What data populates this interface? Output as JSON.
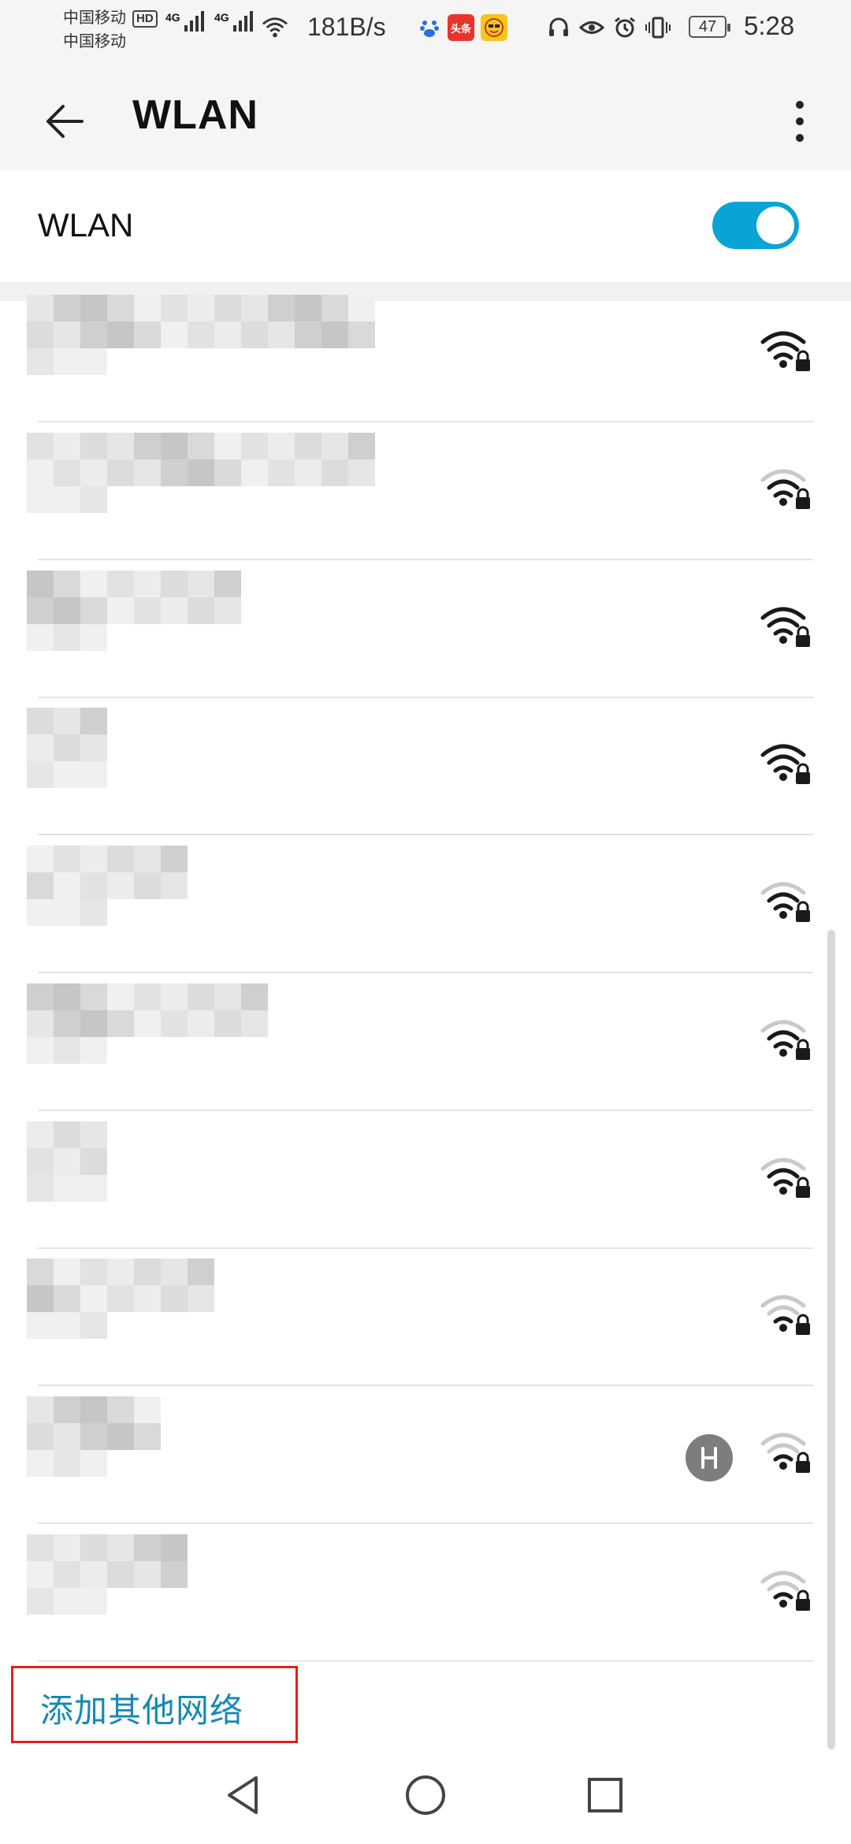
{
  "status_bar": {
    "carrier_1": "中国移动",
    "carrier_2": "中国移动",
    "hd_label": "HD",
    "signal_1_label": "4G",
    "signal_2_label": "4G",
    "net_speed": "181B/s",
    "app_icons": [
      "baidu-icon",
      "toutiao-icon",
      "emoji-app-icon"
    ],
    "toutiao_label": "头条",
    "system_icons": [
      "headphones-icon",
      "eye-icon",
      "alarm-icon",
      "vibrate-icon"
    ],
    "battery": "47",
    "time": "5:28"
  },
  "app_bar": {
    "title": "WLAN",
    "back_icon": "arrow-left-icon",
    "more_icon": "more-vertical-icon"
  },
  "wlan_toggle": {
    "label": "WLAN",
    "on": true,
    "accent": "#0aa3d6"
  },
  "networks": [
    {
      "name": "",
      "secured": true,
      "signal": 3,
      "huawei_share": false
    },
    {
      "name": "",
      "secured": true,
      "signal": 2,
      "huawei_share": false
    },
    {
      "name": "",
      "secured": true,
      "signal": 3,
      "huawei_share": false
    },
    {
      "name": "",
      "secured": true,
      "signal": 3,
      "huawei_share": false
    },
    {
      "name": "",
      "secured": true,
      "signal": 2,
      "huawei_share": false
    },
    {
      "name": "",
      "secured": true,
      "signal": 2,
      "huawei_share": false
    },
    {
      "name": "",
      "secured": true,
      "signal": 2,
      "huawei_share": false
    },
    {
      "name": "",
      "secured": true,
      "signal": 1,
      "huawei_share": false
    },
    {
      "name": "",
      "secured": true,
      "signal": 1,
      "huawei_share": true
    },
    {
      "name": "",
      "secured": true,
      "signal": 1,
      "huawei_share": false
    }
  ],
  "add_network": {
    "label": "添加其他网络",
    "highlight_color": "#e0201c",
    "text_color": "#1589b4"
  },
  "nav_bar": {
    "buttons": [
      "back-triangle-icon",
      "home-circle-icon",
      "recents-square-icon"
    ]
  }
}
